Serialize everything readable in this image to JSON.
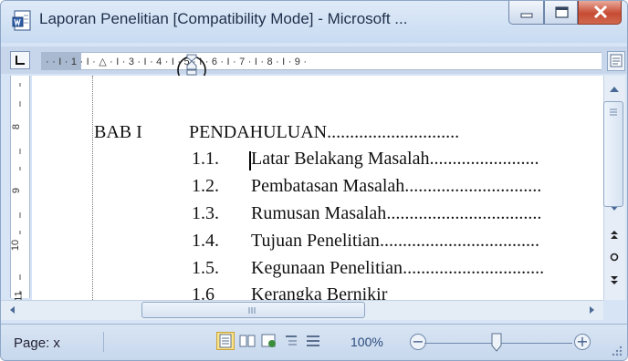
{
  "window": {
    "title": "Laporan Penelitian [Compatibility Mode] - Microsoft ..."
  },
  "ruler": {
    "labels": "· · I · 1 · I · △ · I · 3 · I · 4 · I · 5 · I · 6 · I · 7 · I · 8 · I · 9 ·"
  },
  "vertical_ruler": {
    "labels": [
      "8",
      "9",
      "10",
      "11"
    ]
  },
  "document": {
    "heading": {
      "chapter": "BAB I",
      "title": "PENDAHULUAN",
      "leader": "............................."
    },
    "items": [
      {
        "num": "1.1.",
        "text": "Latar Belakang Masalah",
        "leader": "........................"
      },
      {
        "num": "1.2.",
        "text": "Pembatasan Masalah",
        "leader": ".............................."
      },
      {
        "num": "1.3.",
        "text": "Rumusan Masalah",
        "leader": ".................................."
      },
      {
        "num": "1.4.",
        "text": "Tujuan Penelitian",
        "leader": "..................................."
      },
      {
        "num": "1.5.",
        "text": "Kegunaan Penelitian",
        "leader": "..............................."
      },
      {
        "num": "1.6",
        "text": "Kerangka Bernikir",
        "leader": ""
      }
    ]
  },
  "statusbar": {
    "page": "Page: x",
    "zoom": "100%"
  },
  "colors": {
    "frame": "#d6e4f5",
    "close_button": "#c74b33",
    "active_view": "#fbe38c"
  }
}
